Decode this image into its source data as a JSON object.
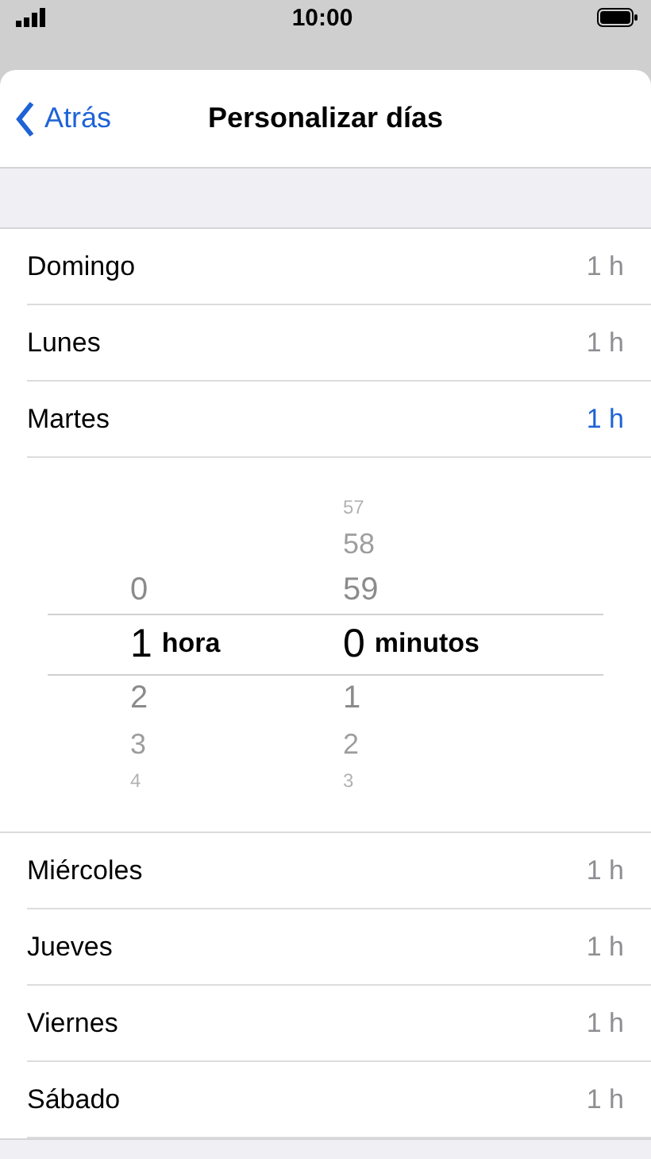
{
  "status_bar": {
    "time": "10:00"
  },
  "nav": {
    "back": "Atrás",
    "title": "Personalizar días"
  },
  "days_before": [
    {
      "day": "Domingo",
      "value": "1 h",
      "selected": false
    },
    {
      "day": "Lunes",
      "value": "1 h",
      "selected": false
    },
    {
      "day": "Martes",
      "value": "1 h",
      "selected": true
    }
  ],
  "picker": {
    "columns": [
      {
        "unit": "hora",
        "items": [
          {
            "value": "0",
            "selected": false
          },
          {
            "value": "1",
            "selected": true
          },
          {
            "value": "2",
            "selected": false
          },
          {
            "value": "3",
            "selected": false
          },
          {
            "value": "4",
            "selected": false
          }
        ]
      },
      {
        "unit": "minutos",
        "items": [
          {
            "value": "57",
            "selected": false
          },
          {
            "value": "58",
            "selected": false
          },
          {
            "value": "59",
            "selected": false
          },
          {
            "value": "0",
            "selected": true
          },
          {
            "value": "1",
            "selected": false
          },
          {
            "value": "2",
            "selected": false
          },
          {
            "value": "3",
            "selected": false
          }
        ]
      }
    ]
  },
  "days_after": [
    {
      "day": "Miércoles",
      "value": "1 h",
      "selected": false
    },
    {
      "day": "Jueves",
      "value": "1 h",
      "selected": false
    },
    {
      "day": "Viernes",
      "value": "1 h",
      "selected": false
    },
    {
      "day": "Sábado",
      "value": "1 h",
      "selected": false
    }
  ]
}
